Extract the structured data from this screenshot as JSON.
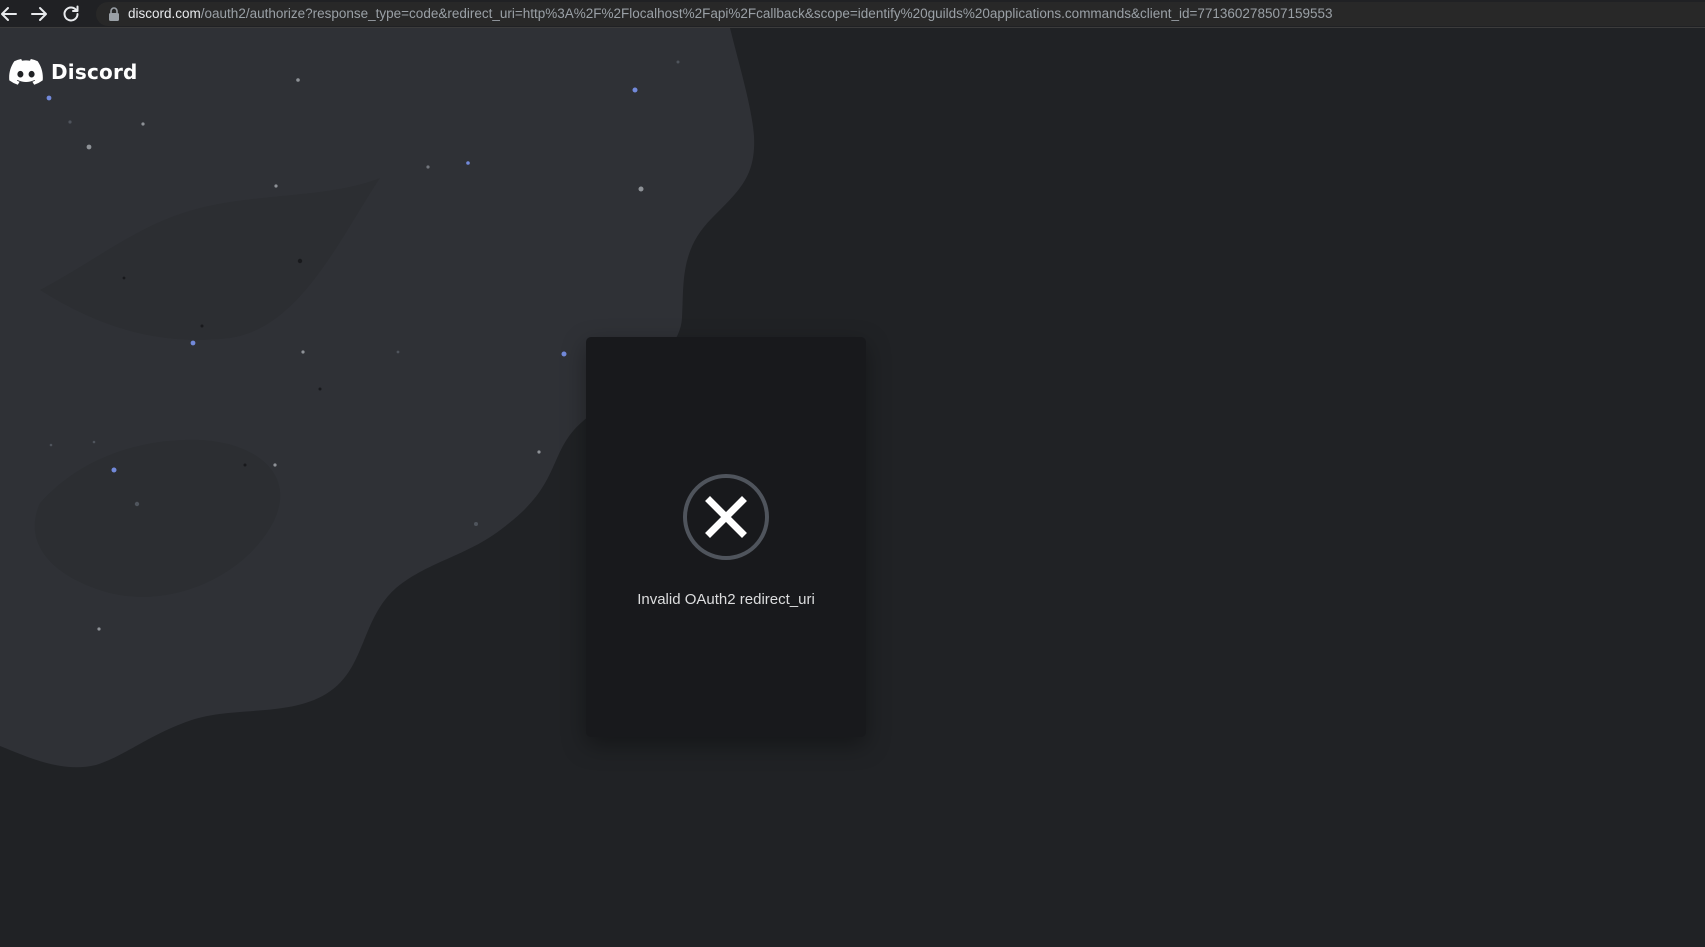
{
  "browser": {
    "url_host": "discord.com",
    "url_path": "/oauth2/authorize?response_type=code&redirect_uri=http%3A%2F%2Flocalhost%2Fapi%2Fcallback&scope=identify%20guilds%20applications.commands&client_id=771360278507159553",
    "icons": {
      "back": "arrow-left-icon",
      "forward": "arrow-right-icon",
      "reload": "reload-icon",
      "secure": "lock-icon"
    }
  },
  "brand": {
    "name": "Discord",
    "logo_icon": "discord-logo-icon"
  },
  "error": {
    "icon": "close-circle-icon",
    "message": "Invalid OAuth2 redirect_uri"
  },
  "colors": {
    "page_background": "#202225",
    "wave_background": "#2f3136",
    "card_background": "#18191c",
    "text": "#dcddde",
    "accent_dots": "#7289da"
  }
}
